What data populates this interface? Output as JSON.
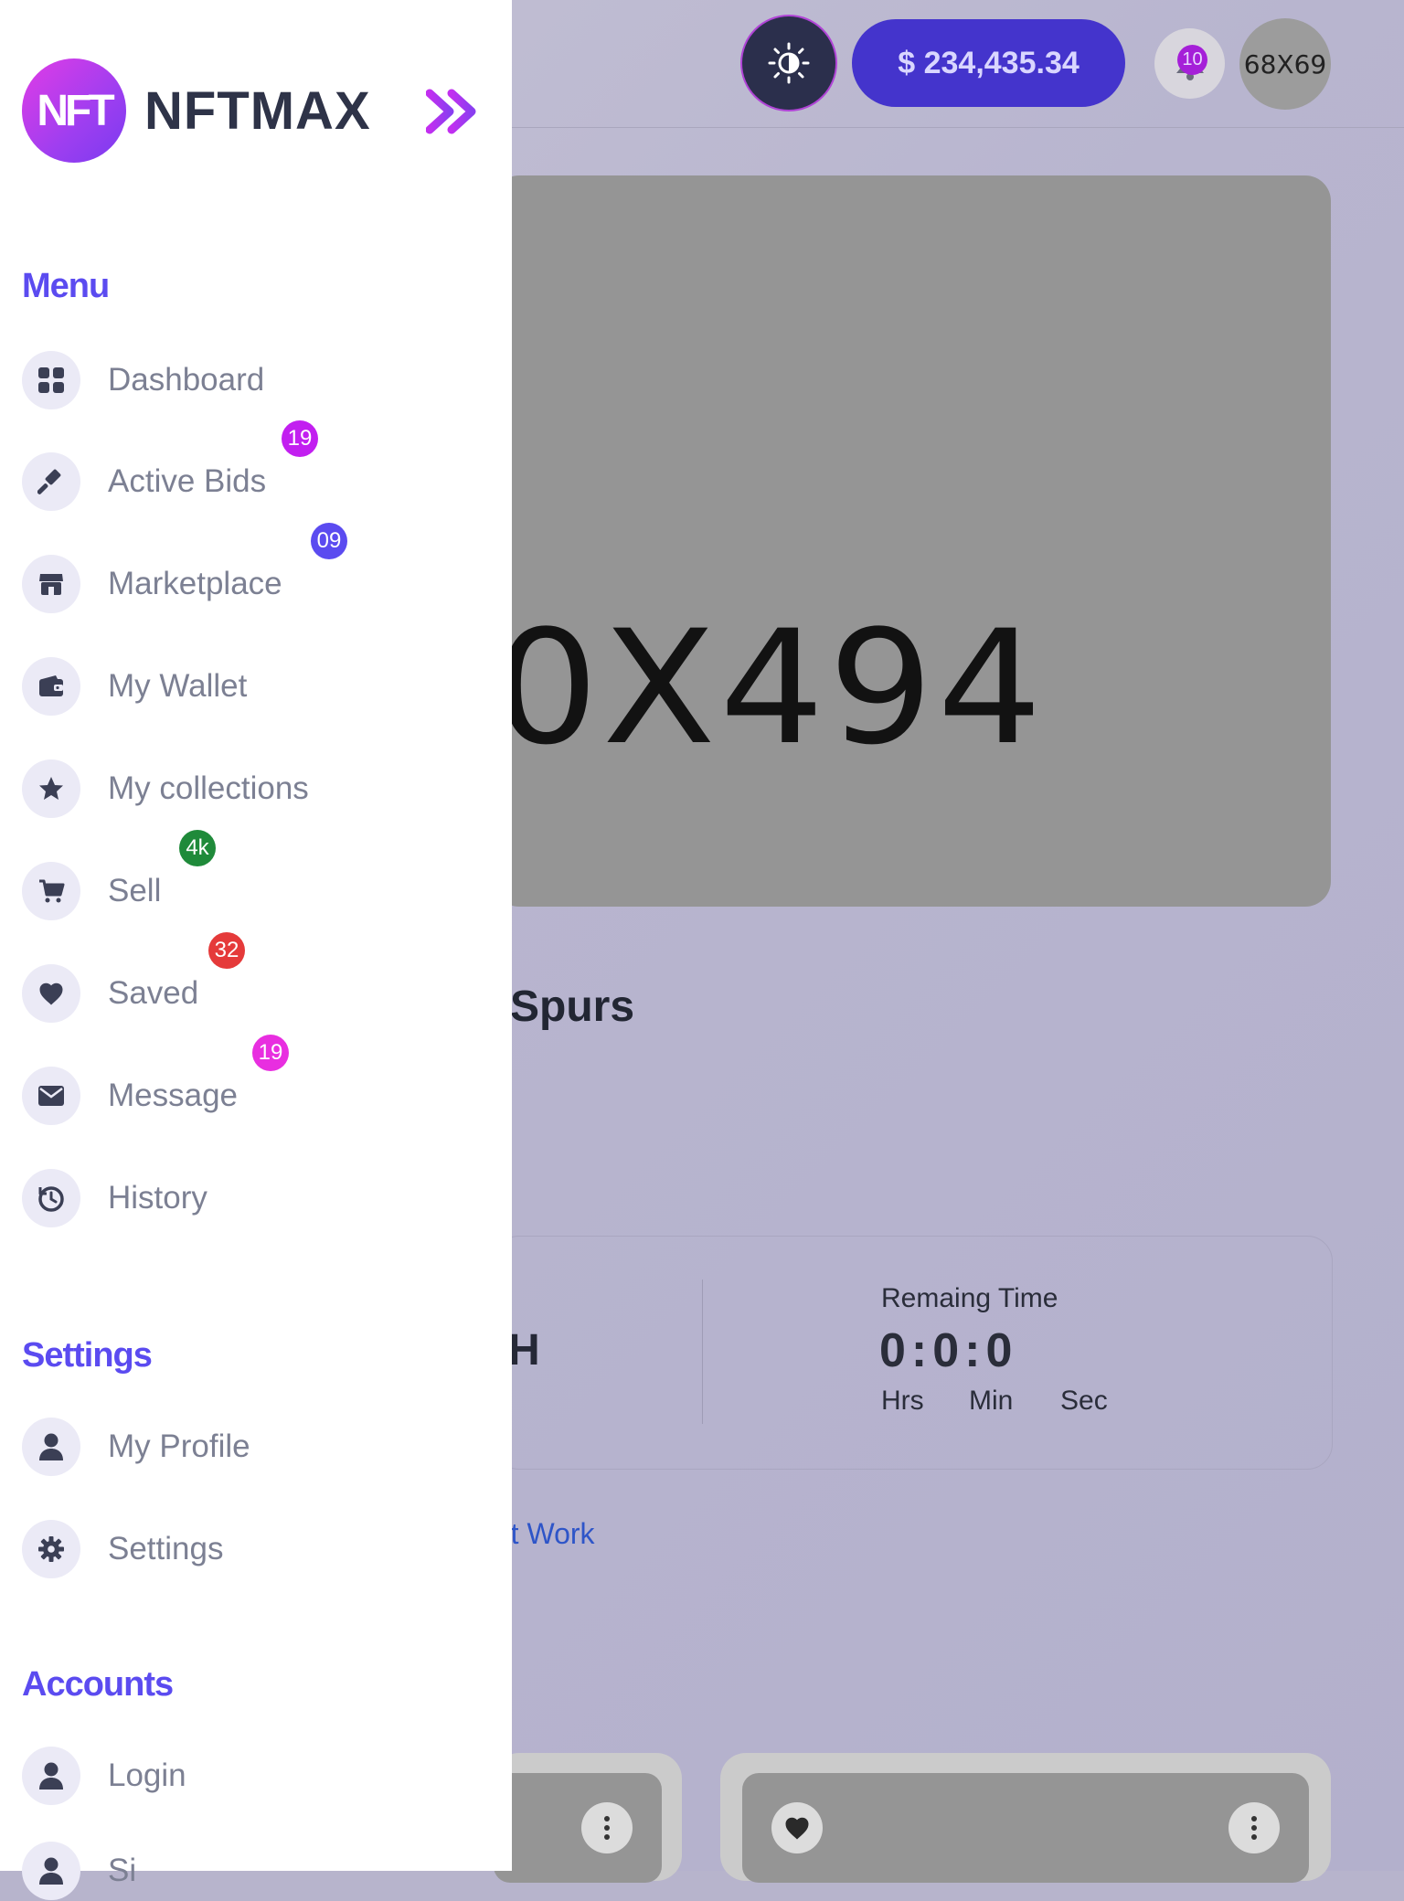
{
  "header": {
    "theme_toggle_icon": "sun-half-icon",
    "balance": "$ 234,435.34",
    "notifications_count": "10",
    "avatar_label": "68X69"
  },
  "hero": {
    "image_placeholder": "0X494",
    "title_fragment": "Spurs"
  },
  "bid_card": {
    "value_fragment": "H",
    "remaining_label": "Remaing Time",
    "remaining_time": "0:0:0",
    "units": [
      "Hrs",
      "Min",
      "Sec"
    ]
  },
  "artwork_link": "rt Work",
  "sidebar": {
    "brand_logo": "NFT",
    "brand_name": "NFTMAX",
    "sections": {
      "menu": "Menu",
      "settings": "Settings",
      "accounts": "Accounts"
    },
    "menu_items": [
      {
        "label": "Dashboard",
        "icon": "dashboard-icon"
      },
      {
        "label": "Active Bids",
        "icon": "gavel-icon",
        "badge": "19",
        "badge_color": "#c21ff0"
      },
      {
        "label": "Marketplace",
        "icon": "store-icon",
        "badge": "09",
        "badge_color": "#5b4bf0"
      },
      {
        "label": "My Wallet",
        "icon": "wallet-icon"
      },
      {
        "label": "My collections",
        "icon": "star-icon"
      },
      {
        "label": "Sell",
        "icon": "cart-icon",
        "badge": "4k",
        "badge_color": "#1f8a3a"
      },
      {
        "label": "Saved",
        "icon": "heart-icon",
        "badge": "32",
        "badge_color": "#e53a3a"
      },
      {
        "label": "Message",
        "icon": "envelope-icon",
        "badge": "19",
        "badge_color": "#e82ee0"
      },
      {
        "label": "History",
        "icon": "history-icon"
      }
    ],
    "settings_items": [
      {
        "label": "My Profile",
        "icon": "user-icon"
      },
      {
        "label": "Settings",
        "icon": "gear-icon"
      }
    ],
    "account_items": [
      {
        "label": "Login",
        "icon": "user-icon"
      },
      {
        "label": "Si",
        "icon": "user-icon"
      }
    ]
  },
  "colors": {
    "accent": "#5b4bf0",
    "balance_pill": "#4434cc",
    "sidebar_bg": "#ffffff",
    "overlay": "#b7b4cc"
  }
}
